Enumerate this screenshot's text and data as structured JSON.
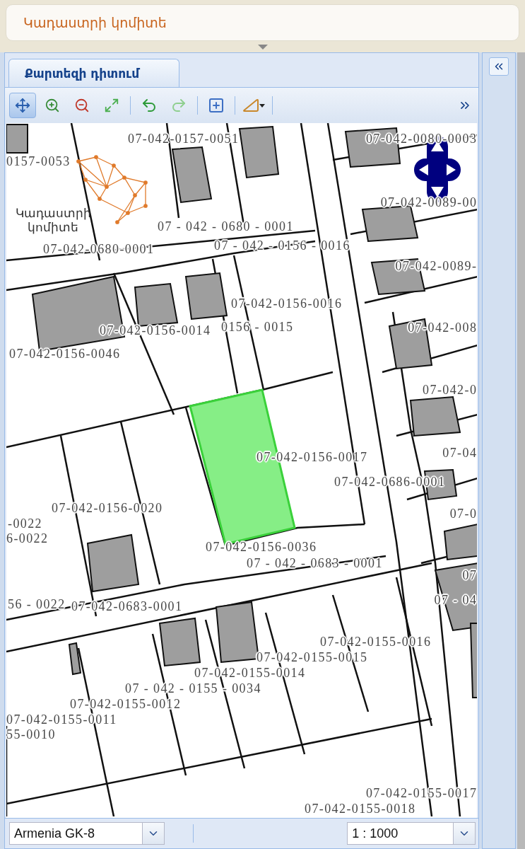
{
  "header": {
    "title": "Կադաստրի կոմիտե"
  },
  "tabs": [
    {
      "label": "Քարտեզի դիտում",
      "selected": true
    }
  ],
  "toolbar": {
    "tools": [
      {
        "kind": "pan",
        "selected": true
      },
      {
        "kind": "zoom_in",
        "selected": false
      },
      {
        "kind": "zoom_out",
        "selected": false
      },
      {
        "kind": "full_extent",
        "selected": false
      },
      {
        "kind": "undo",
        "selected": false
      },
      {
        "kind": "redo",
        "selected": false
      },
      {
        "kind": "select",
        "selected": false
      },
      {
        "kind": "measure",
        "selected": false
      }
    ]
  },
  "map": {
    "logo_text": "Կադաստրի կոմիտե",
    "parcel_labels": [
      "07-042-0157-0051",
      "0157-0053",
      "07-042-0080-0003",
      "07 - 042 - 0680 - 0001",
      "07-042-0680-0001",
      "07 - 042 - 0156 - 0016",
      "07-042-0089-00",
      "07-042-0089-",
      "07-042-0156-0016",
      "07-042-0156-0014",
      "0156 - 0015",
      "07-042-0156-0046",
      "07-042-008",
      "07-042-0",
      "07-042-0156-0017",
      "07-042-0686-0001",
      "07-04",
      "07-042-0156-0020",
      "-0022",
      "6-0022",
      "07-0",
      "07-042-0156-0036",
      "07 - 042 - 0683 - 0001",
      "07",
      "07 - 04",
      "56 - 0022",
      "07-042-0683-0001",
      "07-042-0155-0016",
      "07-042-0155-0015",
      "07-042-0155-0014",
      "07 - 042 - 0155 - 0034",
      "07-042-0155-0012",
      "07-042-0155-0011",
      "55-0010",
      "07-042-0155-0017",
      "07-042-0155-0018"
    ]
  },
  "status_bar": {
    "projection": "Armenia GK-8",
    "scale": "1 : 1000"
  }
}
